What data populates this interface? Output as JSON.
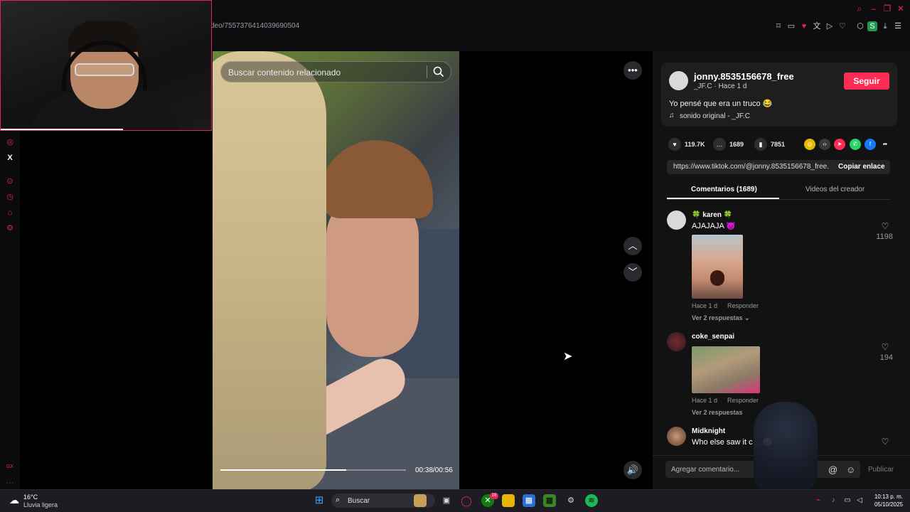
{
  "browser": {
    "url": "deo/7557376414039690504",
    "toolbar_icons": [
      "bookmark-icon",
      "screenshot-icon",
      "pocket-icon",
      "translate-icon",
      "send-icon",
      "heart-icon",
      "extensions-icon",
      "profile-icon",
      "download-icon",
      "menu-icon"
    ],
    "profile_letter": "S",
    "window_controls": [
      "search-icon",
      "minimize-icon",
      "restore-icon",
      "close-icon"
    ]
  },
  "sidebar": {
    "icons": [
      "instagram-icon",
      "x-icon",
      "play-icon",
      "history-icon",
      "tag-icon",
      "settings-icon",
      "gx-icon",
      "more-icon"
    ],
    "x_label": "X",
    "gx_label": "GX"
  },
  "video": {
    "search_placeholder": "Buscar contenido relacionado",
    "time": "00:38/00:56",
    "progress": 0.68
  },
  "post": {
    "username": "jonny.8535156678_free",
    "subline": "_JF.C · Hace 1 d",
    "follow_label": "Seguir",
    "description": "Yo pensé que era un truco 😂",
    "sound": "sonido original - _JF.C",
    "likes": "119.7K",
    "comments": "1689",
    "saves": "7851",
    "link": "https://www.tiktok.com/@jonny.8535156678_free...",
    "copy_label": "Copiar enlace"
  },
  "tabs": {
    "comments": "Comentarios (1689)",
    "creator": "Videos del creador"
  },
  "comments": [
    {
      "user": "🍀 karen 🍀",
      "text": "AJAJAJA 👿",
      "time": "Hace 1 d",
      "reply": "Responder",
      "replies": "Ver 2 respuestas ⌄",
      "likes": "1198"
    },
    {
      "user": "coke_senpai",
      "text": "",
      "time": "Hace 1 d",
      "reply": "Responder",
      "replies": "Ver 2 respuestas",
      "likes": "194"
    },
    {
      "user": "Midknight",
      "text": "Who else saw it c… 😂",
      "likes": ""
    }
  ],
  "comment_box": {
    "placeholder": "Agregar comentario...",
    "publish": "Publicar"
  },
  "taskbar": {
    "temperature": "16°C",
    "weather": "Lluvia ligera",
    "search": "Buscar",
    "time": "10:13 p. m.",
    "date": "05/10/2025",
    "xbox_badge": "18"
  },
  "colors": {
    "accent": "#fe2c55",
    "gx_red": "#e0245e"
  }
}
